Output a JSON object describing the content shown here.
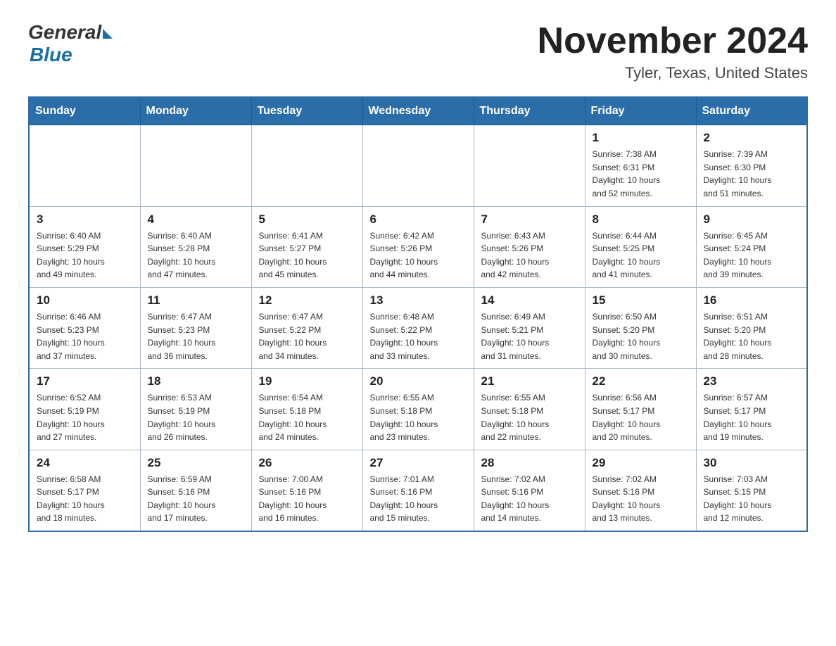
{
  "header": {
    "logo_general": "General",
    "logo_blue": "Blue",
    "month_year": "November 2024",
    "location": "Tyler, Texas, United States"
  },
  "weekdays": [
    "Sunday",
    "Monday",
    "Tuesday",
    "Wednesday",
    "Thursday",
    "Friday",
    "Saturday"
  ],
  "weeks": [
    [
      {
        "day": "",
        "info": ""
      },
      {
        "day": "",
        "info": ""
      },
      {
        "day": "",
        "info": ""
      },
      {
        "day": "",
        "info": ""
      },
      {
        "day": "",
        "info": ""
      },
      {
        "day": "1",
        "info": "Sunrise: 7:38 AM\nSunset: 6:31 PM\nDaylight: 10 hours\nand 52 minutes."
      },
      {
        "day": "2",
        "info": "Sunrise: 7:39 AM\nSunset: 6:30 PM\nDaylight: 10 hours\nand 51 minutes."
      }
    ],
    [
      {
        "day": "3",
        "info": "Sunrise: 6:40 AM\nSunset: 5:29 PM\nDaylight: 10 hours\nand 49 minutes."
      },
      {
        "day": "4",
        "info": "Sunrise: 6:40 AM\nSunset: 5:28 PM\nDaylight: 10 hours\nand 47 minutes."
      },
      {
        "day": "5",
        "info": "Sunrise: 6:41 AM\nSunset: 5:27 PM\nDaylight: 10 hours\nand 45 minutes."
      },
      {
        "day": "6",
        "info": "Sunrise: 6:42 AM\nSunset: 5:26 PM\nDaylight: 10 hours\nand 44 minutes."
      },
      {
        "day": "7",
        "info": "Sunrise: 6:43 AM\nSunset: 5:26 PM\nDaylight: 10 hours\nand 42 minutes."
      },
      {
        "day": "8",
        "info": "Sunrise: 6:44 AM\nSunset: 5:25 PM\nDaylight: 10 hours\nand 41 minutes."
      },
      {
        "day": "9",
        "info": "Sunrise: 6:45 AM\nSunset: 5:24 PM\nDaylight: 10 hours\nand 39 minutes."
      }
    ],
    [
      {
        "day": "10",
        "info": "Sunrise: 6:46 AM\nSunset: 5:23 PM\nDaylight: 10 hours\nand 37 minutes."
      },
      {
        "day": "11",
        "info": "Sunrise: 6:47 AM\nSunset: 5:23 PM\nDaylight: 10 hours\nand 36 minutes."
      },
      {
        "day": "12",
        "info": "Sunrise: 6:47 AM\nSunset: 5:22 PM\nDaylight: 10 hours\nand 34 minutes."
      },
      {
        "day": "13",
        "info": "Sunrise: 6:48 AM\nSunset: 5:22 PM\nDaylight: 10 hours\nand 33 minutes."
      },
      {
        "day": "14",
        "info": "Sunrise: 6:49 AM\nSunset: 5:21 PM\nDaylight: 10 hours\nand 31 minutes."
      },
      {
        "day": "15",
        "info": "Sunrise: 6:50 AM\nSunset: 5:20 PM\nDaylight: 10 hours\nand 30 minutes."
      },
      {
        "day": "16",
        "info": "Sunrise: 6:51 AM\nSunset: 5:20 PM\nDaylight: 10 hours\nand 28 minutes."
      }
    ],
    [
      {
        "day": "17",
        "info": "Sunrise: 6:52 AM\nSunset: 5:19 PM\nDaylight: 10 hours\nand 27 minutes."
      },
      {
        "day": "18",
        "info": "Sunrise: 6:53 AM\nSunset: 5:19 PM\nDaylight: 10 hours\nand 26 minutes."
      },
      {
        "day": "19",
        "info": "Sunrise: 6:54 AM\nSunset: 5:18 PM\nDaylight: 10 hours\nand 24 minutes."
      },
      {
        "day": "20",
        "info": "Sunrise: 6:55 AM\nSunset: 5:18 PM\nDaylight: 10 hours\nand 23 minutes."
      },
      {
        "day": "21",
        "info": "Sunrise: 6:55 AM\nSunset: 5:18 PM\nDaylight: 10 hours\nand 22 minutes."
      },
      {
        "day": "22",
        "info": "Sunrise: 6:56 AM\nSunset: 5:17 PM\nDaylight: 10 hours\nand 20 minutes."
      },
      {
        "day": "23",
        "info": "Sunrise: 6:57 AM\nSunset: 5:17 PM\nDaylight: 10 hours\nand 19 minutes."
      }
    ],
    [
      {
        "day": "24",
        "info": "Sunrise: 6:58 AM\nSunset: 5:17 PM\nDaylight: 10 hours\nand 18 minutes."
      },
      {
        "day": "25",
        "info": "Sunrise: 6:59 AM\nSunset: 5:16 PM\nDaylight: 10 hours\nand 17 minutes."
      },
      {
        "day": "26",
        "info": "Sunrise: 7:00 AM\nSunset: 5:16 PM\nDaylight: 10 hours\nand 16 minutes."
      },
      {
        "day": "27",
        "info": "Sunrise: 7:01 AM\nSunset: 5:16 PM\nDaylight: 10 hours\nand 15 minutes."
      },
      {
        "day": "28",
        "info": "Sunrise: 7:02 AM\nSunset: 5:16 PM\nDaylight: 10 hours\nand 14 minutes."
      },
      {
        "day": "29",
        "info": "Sunrise: 7:02 AM\nSunset: 5:16 PM\nDaylight: 10 hours\nand 13 minutes."
      },
      {
        "day": "30",
        "info": "Sunrise: 7:03 AM\nSunset: 5:15 PM\nDaylight: 10 hours\nand 12 minutes."
      }
    ]
  ]
}
